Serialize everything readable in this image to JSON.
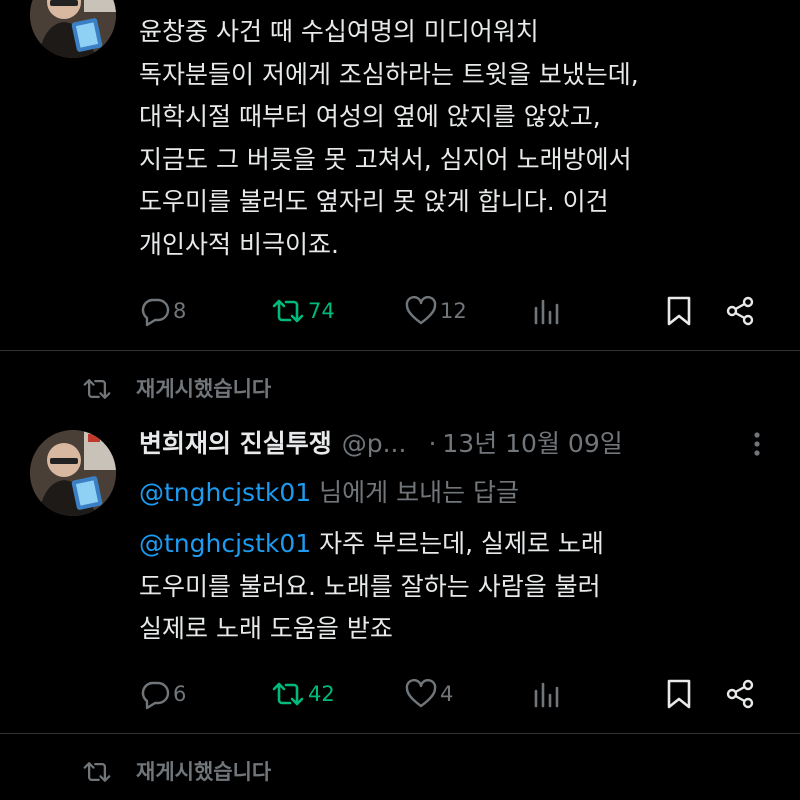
{
  "colors": {
    "background": "#000000",
    "text": "#e7e9ea",
    "muted": "#71767b",
    "mention": "#1d9bf0",
    "retweet_active": "#00ba7c",
    "divider": "#2f3336"
  },
  "tweet1": {
    "lines": [
      "윤창중 사건 때 수십여명의 미디어워치",
      "독자분들이 저에게 조심하라는 트윗을 보냈는데,",
      "대학시절 때부터 여성의 옆에 앉지를 않았고,",
      "지금도 그 버릇을 못 고쳐서, 심지어 노래방에서",
      "도우미를 불러도 옆자리 못 앉게 합니다. 이건",
      "개인사적 비극이죠."
    ],
    "actions": {
      "replies": "8",
      "retweets": "74",
      "likes": "12",
      "reply_icon": "reply-icon",
      "retweet_icon": "retweet-icon",
      "like_icon": "heart-icon",
      "views_icon": "views-icon",
      "bookmark_icon": "bookmark-icon",
      "share_icon": "share-icon"
    }
  },
  "retweet_banner_1": {
    "label": "재게시했습니다"
  },
  "tweet2": {
    "author_name": "변희재의 진실투쟁",
    "handle": "@p...",
    "separator": "·",
    "date": "13년 10월 09일",
    "more_icon": "more-vertical-icon",
    "reply_to": {
      "mention": "@tnghcjstk01",
      "suffix": " 님에게 보내는 답글"
    },
    "body_mention": "@tnghcjstk01",
    "body_lines": [
      " 자주 부르는데, 실제로 노래",
      "도우미를 불러요. 노래를 잘하는 사람을 불러",
      "실제로 노래 도움을 받죠"
    ],
    "actions": {
      "replies": "6",
      "retweets": "42",
      "likes": "4"
    }
  },
  "retweet_banner_2": {
    "label": "재게시했습니다"
  }
}
